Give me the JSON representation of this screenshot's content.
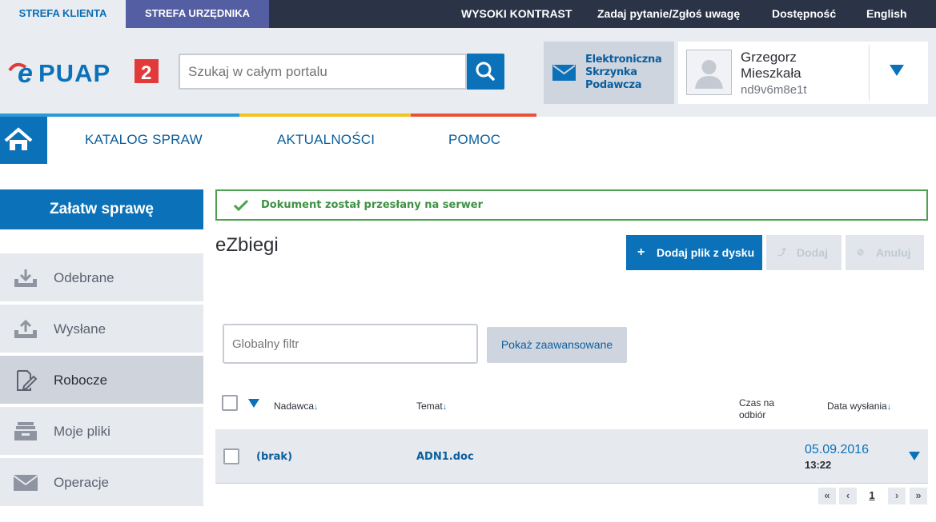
{
  "topbar": {
    "tab_client": "STREFA KLIENTA",
    "tab_official": "STREFA URZĘDNIKA",
    "high_contrast": "WYSOKI KONTRAST",
    "ask_question": "Zadaj pytanie/Zgłoś uwagę",
    "accessibility": "Dostępność",
    "english": "English"
  },
  "header": {
    "search_placeholder": "Szukaj w całym portalu",
    "esp_line1": "Elektroniczna",
    "esp_line2": "Skrzynka",
    "esp_line3": "Podawcza",
    "user_first": "Grzegorz",
    "user_last": "Mieszkała",
    "user_login": "nd9v6m8e1t"
  },
  "nav": {
    "items": [
      {
        "label": "KATALOG SPRAW"
      },
      {
        "label": "AKTUALNOŚCI"
      },
      {
        "label": "POMOC"
      }
    ]
  },
  "sidebar": {
    "main_button": "Załatw sprawę",
    "items": [
      {
        "label": "Odebrane"
      },
      {
        "label": "Wysłane"
      },
      {
        "label": "Robocze"
      },
      {
        "label": "Moje pliki"
      },
      {
        "label": "Operacje"
      }
    ]
  },
  "main": {
    "alert_message": "Dokument został przesłany na serwer",
    "title": "eZbiegi",
    "add_file_button": "Dodaj plik z dysku",
    "add_button": "Dodaj",
    "cancel_button": "Anuluj",
    "filter_placeholder": "Globalny filtr",
    "advanced_button": "Pokaż zaawansowane",
    "table": {
      "columns": {
        "sender": "Nadawca",
        "subject": "Temat",
        "pickup_time_1": "Czas na",
        "pickup_time_2": "odbiór",
        "sent_date": "Data wysłania"
      },
      "rows": [
        {
          "sender": "(brak)",
          "subject": "ADN1.doc",
          "date": "05.09.2016",
          "time": "13:22"
        }
      ]
    },
    "pagination": {
      "first": "«",
      "prev": "‹",
      "current": "1",
      "next": "›",
      "last": "»"
    }
  },
  "colors": {
    "primary": "#0b72b9",
    "topbar": "#2b3346",
    "official_tab": "#545ea2",
    "success": "#4aa14f",
    "bar_blue": "#2a9ad6",
    "bar_yellow": "#f3c321",
    "bar_red": "#e8523a"
  }
}
